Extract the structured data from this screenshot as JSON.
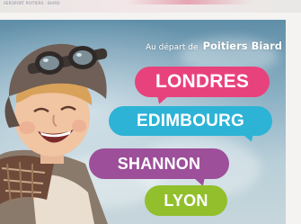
{
  "top_strip": {
    "text": "AEROPORT POITIERS - BIARD"
  },
  "banner": {
    "origin_prefix": "Au départ de",
    "origin_airport": "Poitiers Biard",
    "destinations": [
      "LONDRES",
      "EDIMBOURG",
      "SHANNON",
      "LYON"
    ],
    "colors": {
      "londres": "#e8427c",
      "edimbourg": "#2db3d6",
      "shannon": "#9d4f9a",
      "lyon": "#92bf2c",
      "sky": "#8fb3c6"
    },
    "image": "child-aviator-photo"
  }
}
